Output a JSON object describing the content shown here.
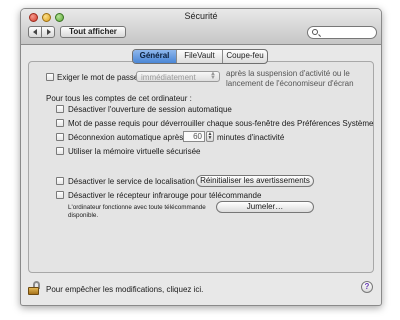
{
  "window": {
    "title": "Sécurité"
  },
  "toolbar": {
    "show_all": "Tout afficher",
    "search": {
      "value": "",
      "placeholder": ""
    }
  },
  "tabs": [
    {
      "label": "Général",
      "active": true
    },
    {
      "label": "FileVault",
      "active": false
    },
    {
      "label": "Coupe-feu",
      "active": false
    }
  ],
  "general": {
    "require_password_label": "Exiger le mot de passe",
    "require_password_popup": "immédiatement",
    "require_password_after_1": "après la suspension d'activité ou le",
    "require_password_after_2": "lancement de l'économiseur d'écran",
    "all_accounts_header": "Pour tous les comptes de cet ordinateur :",
    "disable_auto_login": "Désactiver l'ouverture de session automatique",
    "password_unlock_prefs": "Mot de passe requis pour déverrouiller chaque sous-fenêtre des Préférences Système",
    "auto_logout_label": "Déconnexion automatique après",
    "auto_logout_value": "60",
    "auto_logout_unit": "minutes d'inactivité",
    "secure_virtual_memory": "Utiliser la mémoire virtuelle sécurisée",
    "disable_location": "Désactiver le service de localisation",
    "reset_warnings_button": "Réinitialiser les avertissements",
    "disable_ir_receiver": "Désactiver le récepteur infrarouge pour télécommande",
    "ir_info_1": "L'ordinateur fonctionne avec toute télécommande",
    "ir_info_2": "disponible.",
    "pair_button": "Jumeler…"
  },
  "footer": {
    "lock_text": "Pour empêcher les modifications, cliquez ici.",
    "help_glyph": "?"
  },
  "icons": {
    "lock": "lock-icon",
    "help": "help-icon",
    "search": "search-icon"
  },
  "colors": {
    "tab_active": "#4a86d6",
    "window_bg": "#e8e8e8"
  }
}
